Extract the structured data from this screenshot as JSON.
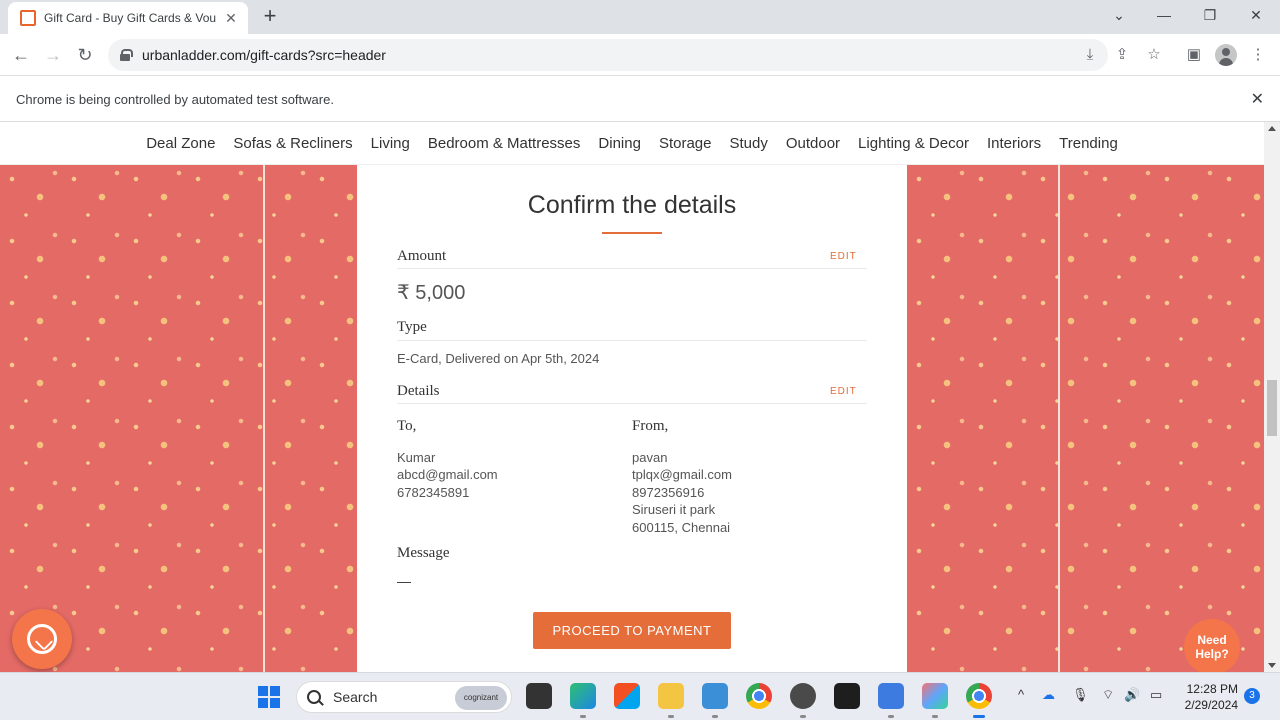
{
  "browser": {
    "tab_title": "Gift Card - Buy Gift Cards & Vou",
    "url": "urbanladder.com/gift-cards?src=header",
    "infobar_message": "Chrome is being controlled by automated test software."
  },
  "nav": {
    "categories": [
      "Deal Zone",
      "Sofas & Recliners",
      "Living",
      "Bedroom & Mattresses",
      "Dining",
      "Storage",
      "Study",
      "Outdoor",
      "Lighting & Decor",
      "Interiors",
      "Trending"
    ]
  },
  "confirm": {
    "title": "Confirm the details",
    "amount_label": "Amount",
    "amount_edit": "EDIT",
    "amount_value": "₹ 5,000",
    "type_label": "Type",
    "type_value": "E-Card, Delivered on Apr 5th, 2024",
    "details_label": "Details",
    "details_edit": "EDIT",
    "to_label": "To,",
    "to_lines": [
      "Kumar",
      "abcd@gmail.com",
      "6782345891"
    ],
    "from_label": "From,",
    "from_lines": [
      "pavan",
      "tplqx@gmail.com",
      "8972356916",
      "Siruseri it park",
      "600115, Chennai"
    ],
    "message_label": "Message",
    "message_value": "—",
    "proceed_label": "PROCEED TO PAYMENT"
  },
  "widgets": {
    "need_help": "Need Help?"
  },
  "taskbar": {
    "search_placeholder": "Search",
    "search_badge": "cognizant",
    "time": "12:28 PM",
    "date": "2/29/2024",
    "notification_count": "3"
  }
}
